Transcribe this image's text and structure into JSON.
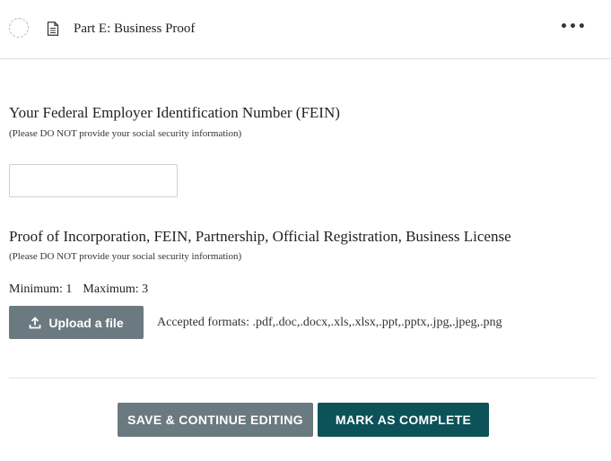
{
  "header": {
    "title": "Part E: Business Proof",
    "more_label": "•••",
    "status_icon": "incomplete-status-icon",
    "doc_icon": "document-icon"
  },
  "fein": {
    "title": "Your Federal Employer Identification Number (FEIN)",
    "note": "(Please DO NOT provide your social security information)",
    "value": "",
    "placeholder": ""
  },
  "proof": {
    "title": "Proof of Incorporation, FEIN, Partnership, Official Registration, Business License",
    "note": "(Please DO NOT provide your social security information)",
    "minimum": "Minimum: 1",
    "maximum": "Maximum: 3",
    "upload_label": "Upload a file",
    "upload_icon": "upload-icon",
    "formats": "Accepted formats: .pdf,.doc,.docx,.xls,.xlsx,.ppt,.pptx,.jpg,.jpeg,.png"
  },
  "footer": {
    "save_label": "SAVE & CONTINUE EDITING",
    "complete_label": "MARK AS COMPLETE"
  },
  "colors": {
    "secondary_button": "#6b7a80",
    "primary_button": "#0d5258",
    "divider": "#dcdcdc"
  }
}
